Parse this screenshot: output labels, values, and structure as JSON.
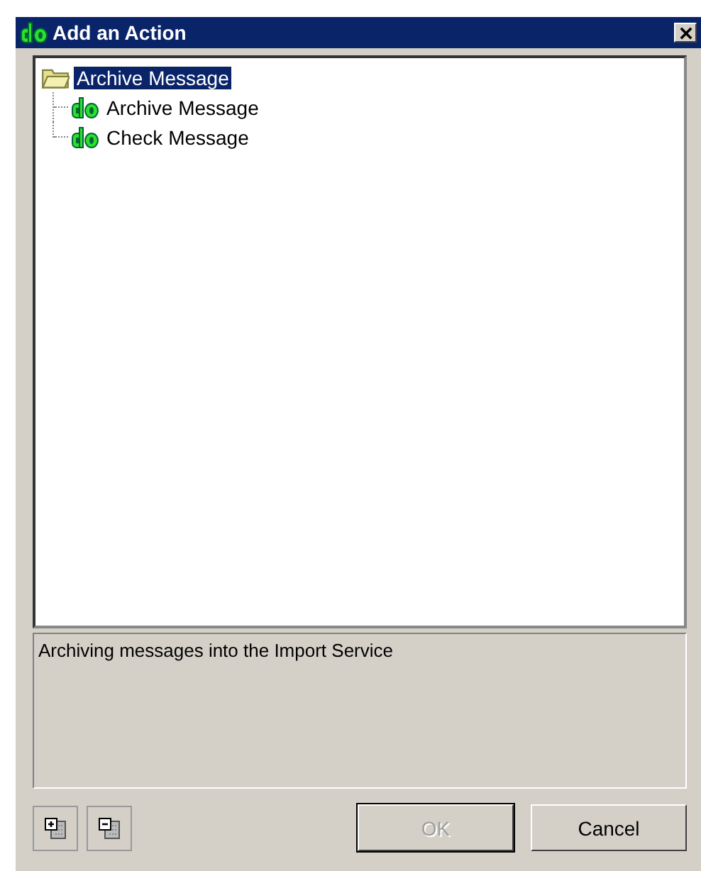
{
  "window": {
    "title": "Add an Action"
  },
  "tree": [
    {
      "label": "Archive Message",
      "kind": "folder",
      "selected": true,
      "expanded": true,
      "children": [
        {
          "label": "Archive Message",
          "kind": "action",
          "selected": false
        },
        {
          "label": "Check Message",
          "kind": "action",
          "selected": false
        }
      ]
    }
  ],
  "description": "Archiving messages into the Import Service",
  "buttons": [
    {
      "label": "OK",
      "disabled": true
    },
    {
      "label": "Cancel",
      "disabled": false
    }
  ]
}
